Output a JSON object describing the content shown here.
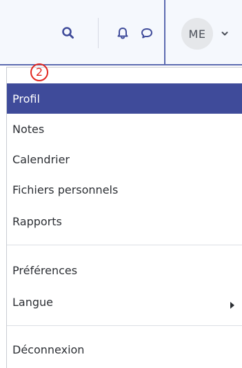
{
  "navbar": {
    "search_icon": "search-icon",
    "bell_icon": "bell-icon",
    "chat_icon": "chat-bubble-icon",
    "avatar_initials": "ME",
    "chevron_icon": "chevron-down-icon",
    "accent_color": "#3f4b9a"
  },
  "annotation": {
    "step": "2",
    "color": "#e2261f"
  },
  "menu": {
    "items": [
      {
        "label": "Profil",
        "active": true
      },
      {
        "label": "Notes"
      },
      {
        "label": "Calendrier"
      },
      {
        "label": "Fichiers personnels"
      },
      {
        "label": "Rapports"
      },
      {
        "label": "Préférences"
      },
      {
        "label": "Langue",
        "has_submenu": true
      },
      {
        "label": "Déconnexion"
      }
    ]
  }
}
